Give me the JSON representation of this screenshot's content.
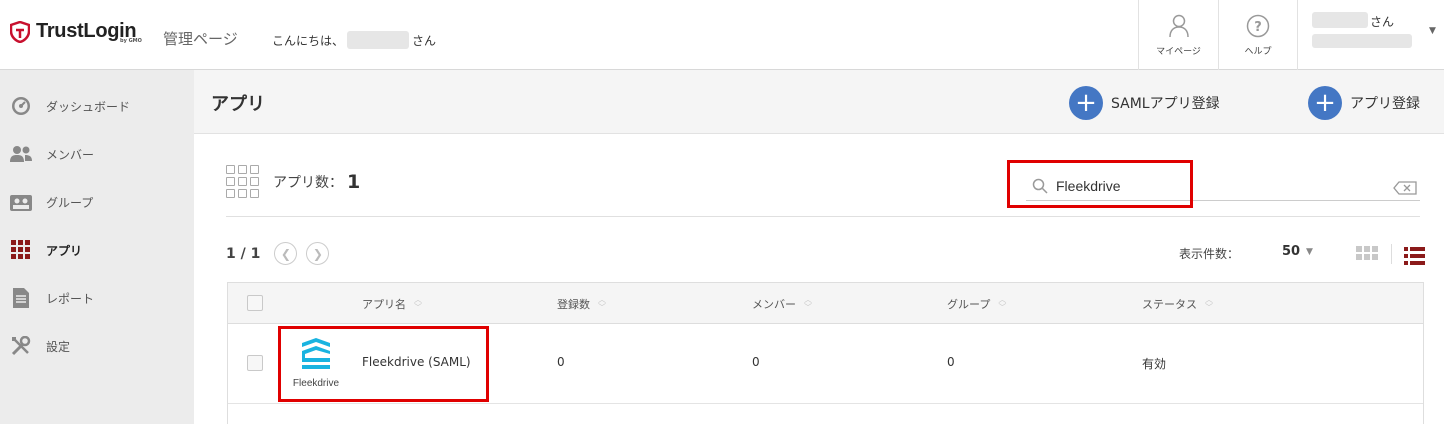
{
  "brand": {
    "name": "TrustLogin",
    "by": "by GMO"
  },
  "header": {
    "admin_title": "管理ページ",
    "greeting_prefix": "こんにちは、",
    "greeting_suffix": "さん",
    "mypage_label": "マイページ",
    "help_label": "ヘルプ",
    "user_suffix": "さん"
  },
  "sidebar": {
    "items": [
      {
        "label": "ダッシュボード",
        "icon": "dashboard-gauge-icon"
      },
      {
        "label": "メンバー",
        "icon": "members-icon"
      },
      {
        "label": "グループ",
        "icon": "group-icon"
      },
      {
        "label": "アプリ",
        "icon": "apps-grid-icon",
        "active": true
      },
      {
        "label": "レポート",
        "icon": "report-document-icon"
      },
      {
        "label": "設定",
        "icon": "settings-tools-icon"
      }
    ]
  },
  "page": {
    "title": "アプリ",
    "saml_add_label": "SAMLアプリ登録",
    "app_add_label": "アプリ登録"
  },
  "summary": {
    "count_label": "アプリ数：",
    "count_value": "1"
  },
  "search": {
    "value": "Fleekdrive"
  },
  "pagination": {
    "page_text": "1 / 1"
  },
  "per_page": {
    "label": "表示件数：",
    "value": "50"
  },
  "table": {
    "columns": [
      "アプリ名",
      "登録数",
      "メンバー",
      "グループ",
      "ステータス"
    ],
    "rows": [
      {
        "logo_text": "Fleekdrive",
        "app_name": "Fleekdrive (SAML)",
        "registrations": "0",
        "members": "0",
        "groups": "0",
        "status": "有効"
      }
    ]
  },
  "colors": {
    "accent_blue": "#4477c4",
    "active_maroon": "#8b1a1a",
    "highlight_red": "#e00000",
    "logo_cyan": "#19b3e0"
  }
}
